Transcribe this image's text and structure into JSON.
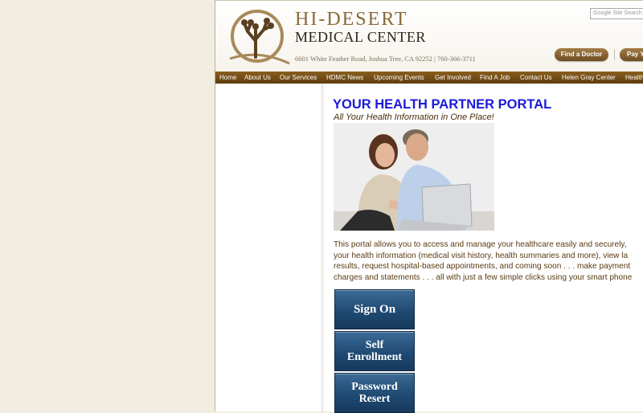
{
  "header": {
    "org_name_line1": "HI-DESERT",
    "org_name_line2": "MEDICAL CENTER",
    "address": "6601 White Feather Road, Joshua Tree, CA 92252  |  760-366-3711",
    "search_placeholder": "Google  Site Search",
    "find_doctor_label": "Find a Doctor",
    "pay_label": "Pay Y"
  },
  "nav": {
    "items": [
      "Home",
      "About Us",
      "Our Services",
      "HDMC News",
      "Upcoming Events",
      "Get Involved",
      "Find A Job",
      "Contact Us",
      "Helen Gray Center",
      "Health"
    ]
  },
  "main": {
    "title": "YOUR HEALTH PARTNER PORTAL",
    "subtitle": "All Your Health Information in One Place!",
    "description_lines": [
      "This portal allows you to access and manage your healthcare easily and securely,",
      "your health information (medical visit history, health summaries and more), view la",
      "results, request hospital-based appointments, and coming soon . . . make payment",
      "charges and statements . . . all with just a few simple clicks using your smart phone"
    ],
    "buttons": {
      "sign_on": "Sign On",
      "self_enrollment_1": "Self",
      "self_enrollment_2": "Enrollment",
      "password_reset_1": "Password",
      "password_reset_2": "Resert"
    }
  },
  "colors": {
    "page_bg": "#f1ede0",
    "nav_bg": "#7a5218",
    "title_blue": "#1a1ad8",
    "text_brown": "#5a3a12",
    "button_blue": "#1f4a74"
  }
}
